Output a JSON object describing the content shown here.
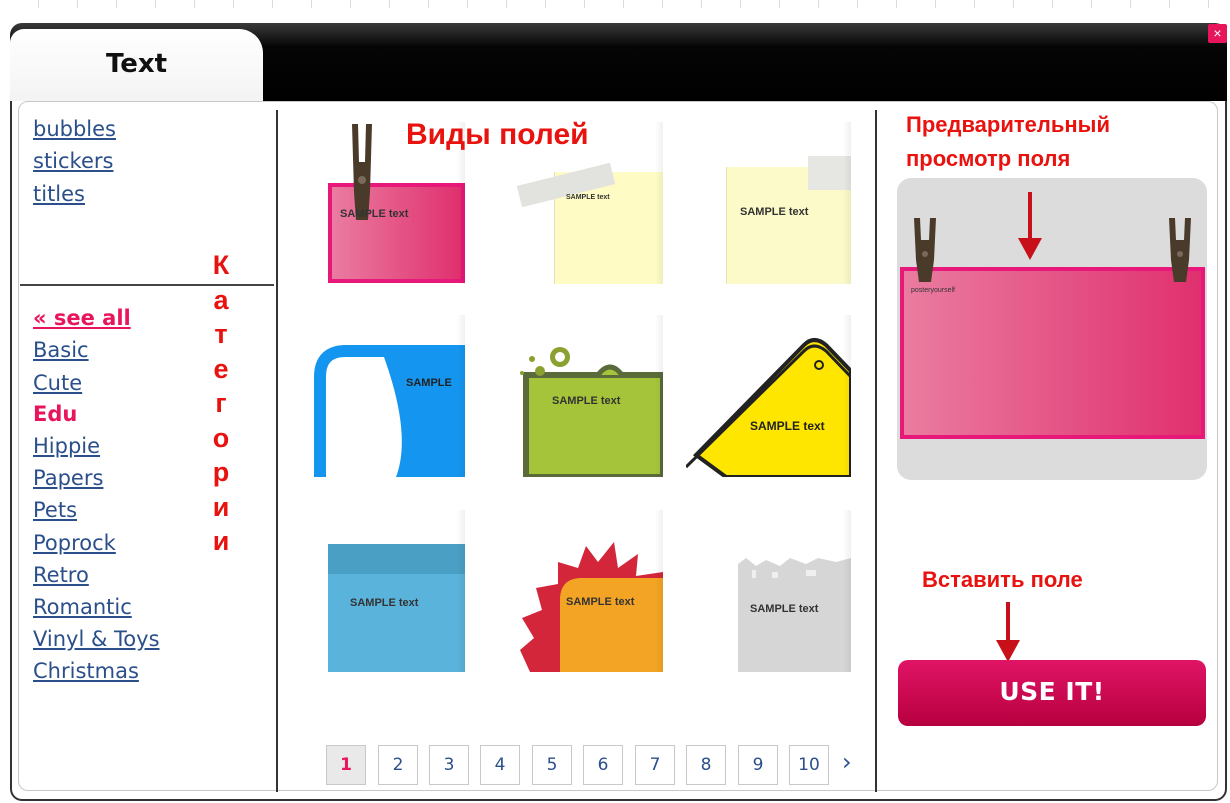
{
  "window": {
    "tab_title": "Text",
    "close_glyph": "×"
  },
  "categories_top": [
    {
      "label": "bubbles"
    },
    {
      "label": "stickers"
    },
    {
      "label": "titles"
    }
  ],
  "categories_bottom": {
    "see_all": "« see all",
    "items": [
      {
        "label": "Basic"
      },
      {
        "label": "Cute"
      },
      {
        "label": "Edu"
      },
      {
        "label": "Hippie"
      },
      {
        "label": "Papers"
      },
      {
        "label": "Pets"
      },
      {
        "label": "Poprock"
      },
      {
        "label": "Retro"
      },
      {
        "label": "Romantic"
      },
      {
        "label": "Vinyl & Toys"
      },
      {
        "label": "Christmas"
      }
    ]
  },
  "annotations": {
    "categories_vertical": [
      "К",
      "а",
      "т",
      "е",
      "г",
      "о",
      "р",
      "и",
      "и"
    ],
    "field_types": "Виды полей",
    "preview_title_line1": "Предварительный",
    "preview_title_line2": "просмотр поля",
    "insert_field": "Вставить поле"
  },
  "thumbnails": [
    {
      "sample": "SAMPLE text"
    },
    {
      "sample": "SAMPLE text"
    },
    {
      "sample": "SAMPLE text"
    },
    {
      "sample": "SAMPLE"
    },
    {
      "sample": "SAMPLE text"
    },
    {
      "sample": "SAMPLE text"
    },
    {
      "sample": "SAMPLE text"
    },
    {
      "sample": "SAMPLE text"
    },
    {
      "sample": "SAMPLE text"
    }
  ],
  "preview": {
    "caption": "posteryourself"
  },
  "use_button": {
    "label": "USE IT!"
  },
  "pagination": {
    "pages": [
      "1",
      "2",
      "3",
      "4",
      "5",
      "6",
      "7",
      "8",
      "9",
      "10"
    ],
    "current": "1",
    "next_glyph": "›"
  },
  "colors": {
    "accent_pink": "#e8155b",
    "annotation_red": "#e8120e",
    "link_blue": "#2a4f8a"
  }
}
